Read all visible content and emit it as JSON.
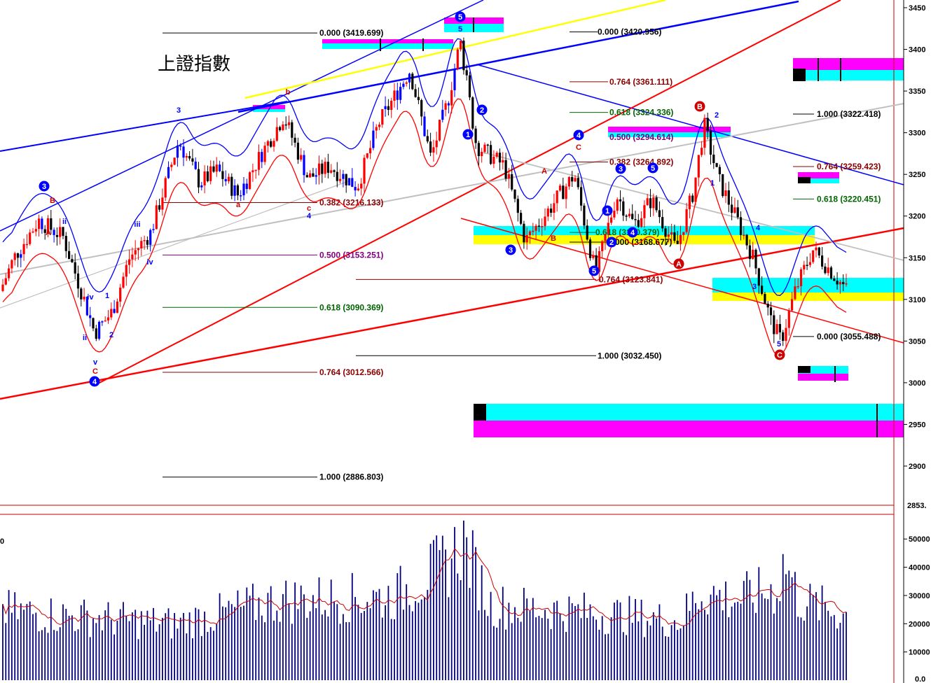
{
  "chart_data": {
    "type": "candlestick",
    "title": "上證指數",
    "price_axis": {
      "ticks": [
        3450,
        3400,
        3350,
        3300,
        3250,
        3200,
        3150,
        3100,
        3050,
        3000,
        2950,
        2900
      ],
      "ylim": [
        2853,
        3460
      ],
      "last_label": "2853."
    },
    "volume_axis": {
      "ticks": [
        50000,
        40000,
        30000,
        20000,
        10000
      ],
      "ylim": [
        0,
        57000
      ],
      "left_fragment": "0",
      "corner_label": "0.0"
    },
    "fib_levels": [
      {
        "label": "0.000 (3419.699)",
        "value": 3419.699,
        "color": "#000000"
      },
      {
        "label": "0.382 (3216.133)",
        "value": 3216.133,
        "color": "#8b0000"
      },
      {
        "label": "0.500 (3153.251)",
        "value": 3153.251,
        "color": "#800080"
      },
      {
        "label": "0.618 (3090.369)",
        "value": 3090.369,
        "color": "#006400"
      },
      {
        "label": "0.764 (3012.566)",
        "value": 3012.566,
        "color": "#8b0000"
      },
      {
        "label": "1.000 (2886.803)",
        "value": 2886.803,
        "color": "#000000"
      },
      {
        "label": "0.000 (3420.956)",
        "value": 3420.956,
        "color": "#000000"
      },
      {
        "label": "0.764 (3361.111)",
        "value": 3361.111,
        "color": "#8b0000"
      },
      {
        "label": "0.618 (3324.336)",
        "value": 3324.336,
        "color": "#006400"
      },
      {
        "label": "0.500 (3294.614)",
        "value": 3294.614,
        "color": "#800080"
      },
      {
        "label": "0.382 (3264.892)",
        "value": 3264.892,
        "color": "#8b0000"
      },
      {
        "label": "0.618 (3180.379)",
        "value": 3180.379,
        "color": "#006400"
      },
      {
        "label": "0.000 (3168.677)",
        "value": 3168.677,
        "color": "#000000"
      },
      {
        "label": "0.764 (3123.841)",
        "value": 3123.841,
        "color": "#8b0000"
      },
      {
        "label": "1.000 (3032.450)",
        "value": 3032.45,
        "color": "#000000"
      },
      {
        "label": "1.000 (3322.418)",
        "value": 3322.418,
        "color": "#000000"
      },
      {
        "label": "0.764 (3259.423)",
        "value": 3259.423,
        "color": "#8b0000"
      },
      {
        "label": "0.618 (3220.451)",
        "value": 3220.451,
        "color": "#006400"
      },
      {
        "label": "0.000 (3055.488)",
        "value": 3055.488,
        "color": "#000000"
      }
    ],
    "wave_labels": [
      {
        "t": "3",
        "c": "#0000ff"
      },
      {
        "t": "B",
        "c": "#cc0000"
      },
      {
        "t": "A",
        "c": "#cc0000"
      },
      {
        "t": "ii",
        "c": "#0000ff"
      },
      {
        "t": "iv",
        "c": "#0000ff"
      },
      {
        "t": "1",
        "c": "#0000ff"
      },
      {
        "t": "ii",
        "c": "#0000ff"
      },
      {
        "t": "v",
        "c": "#0000ff"
      },
      {
        "t": "C",
        "c": "#cc0000"
      },
      {
        "t": "4",
        "c": "#0000ff"
      },
      {
        "t": "2",
        "c": "#0000ff"
      },
      {
        "t": "iii",
        "c": "#0000ff"
      },
      {
        "t": "iv",
        "c": "#0000ff"
      },
      {
        "t": "3",
        "c": "#0000ff"
      },
      {
        "t": "a",
        "c": "#cc0000"
      },
      {
        "t": "b",
        "c": "#cc0000"
      },
      {
        "t": "c",
        "c": "#cc0000"
      },
      {
        "t": "4",
        "c": "#0000ff"
      },
      {
        "t": "5",
        "c": "#0000ff"
      },
      {
        "t": "5",
        "c": "#0000ff"
      },
      {
        "t": "1",
        "c": "#0000ff"
      },
      {
        "t": "2",
        "c": "#0000ff"
      },
      {
        "t": "A",
        "c": "#cc0000"
      },
      {
        "t": "3",
        "c": "#0000ff"
      },
      {
        "t": "B",
        "c": "#cc0000"
      },
      {
        "t": "4",
        "c": "#0000ff"
      },
      {
        "t": "C",
        "c": "#cc0000"
      },
      {
        "t": "3",
        "c": "#0000ff"
      },
      {
        "t": "5",
        "c": "#0000ff"
      },
      {
        "t": "1",
        "c": "#0000ff"
      },
      {
        "t": "2",
        "c": "#0000ff"
      },
      {
        "t": "4",
        "c": "#0000ff"
      },
      {
        "t": "5",
        "c": "#0000ff"
      },
      {
        "t": "A",
        "c": "#cc0000"
      },
      {
        "t": "B",
        "c": "#cc0000"
      },
      {
        "t": "2",
        "c": "#0000ff"
      },
      {
        "t": "1",
        "c": "#0000ff"
      },
      {
        "t": "4",
        "c": "#0000ff"
      },
      {
        "t": "3",
        "c": "#0000ff"
      },
      {
        "t": "5",
        "c": "#0000ff"
      },
      {
        "t": "C",
        "c": "#cc0000"
      }
    ],
    "colors": {
      "up_candle": "#ff0000",
      "down_candle": "#000000",
      "wave_candle": "#0000ff",
      "upper_band": "#0000ff",
      "lower_band": "#ff0000",
      "cyan_zone": "#00ffff",
      "magenta_zone": "#ff00ff",
      "yellow_zone": "#ffff00",
      "trend_blue": "#0000ff",
      "trend_red": "#ff0000",
      "trend_yellow": "#ffff00",
      "trend_gray": "#c0c0c0",
      "volume_bar": "#000080",
      "volume_ma": "#cc0000"
    }
  }
}
